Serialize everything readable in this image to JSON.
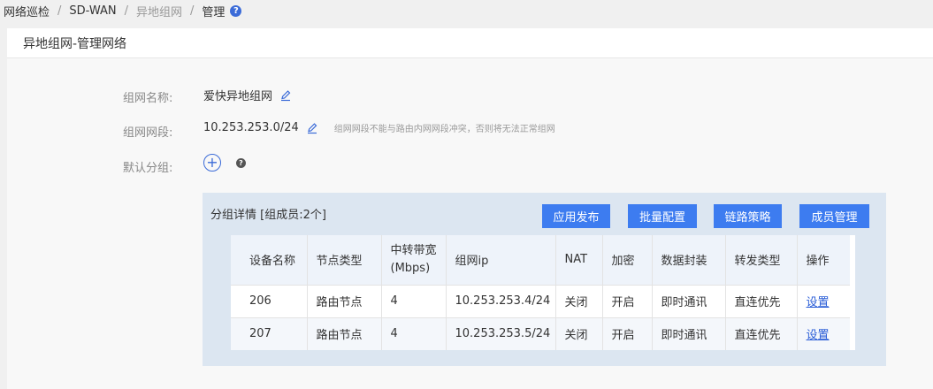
{
  "breadcrumb": {
    "items": [
      "网络巡检",
      "SD-WAN",
      "异地组网",
      "管理"
    ],
    "help": "?"
  },
  "panel": {
    "title": "异地组网-管理网络"
  },
  "form": {
    "name_label": "组网名称:",
    "name_value": "爱快异地组网",
    "segment_label": "组网网段:",
    "segment_value": "10.253.253.0/24",
    "segment_hint": "组网网段不能与路由内网网段冲突，否则将无法正常组网",
    "default_group_label": "默认分组:",
    "add_symbol": "+",
    "help_symbol": "?"
  },
  "group": {
    "title": "分组详情 [组成员:2个]",
    "buttons": [
      "应用发布",
      "批量配置",
      "链路策略",
      "成员管理"
    ],
    "columns": [
      "设备名称",
      "节点类型",
      "中转带宽(Mbps)",
      "组网ip",
      "NAT",
      "加密",
      "数据封装",
      "转发类型",
      "操作"
    ],
    "rows": [
      [
        "206",
        "路由节点",
        "4",
        "10.253.253.4/24",
        "关闭",
        "开启",
        "即时通讯",
        "直连优先",
        "设置"
      ],
      [
        "207",
        "路由节点",
        "4",
        "10.253.253.5/24",
        "关闭",
        "开启",
        "即时通讯",
        "直连优先",
        "设置"
      ]
    ]
  }
}
